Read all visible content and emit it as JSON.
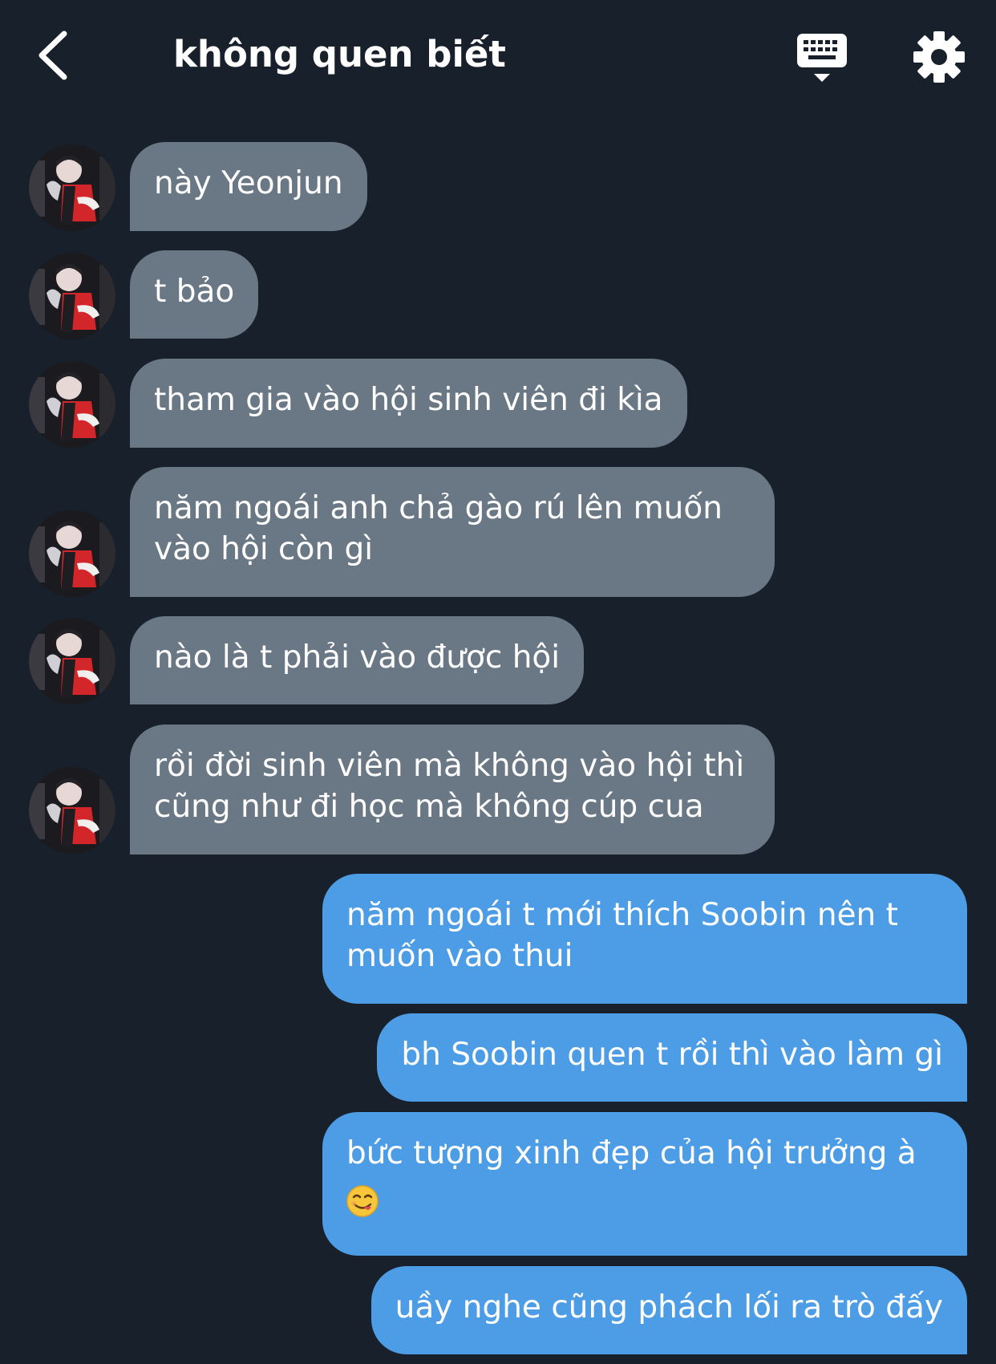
{
  "header": {
    "title": "không quen biết",
    "icons": {
      "back": "chevron-left-icon",
      "keyboard": "keyboard-icon",
      "settings": "gear-icon"
    }
  },
  "messages": [
    {
      "side": "in",
      "lines": [
        "này Yeonjun"
      ]
    },
    {
      "side": "in",
      "lines": [
        "t bảo"
      ]
    },
    {
      "side": "in",
      "lines": [
        "tham gia vào hội sinh viên đi kìa"
      ]
    },
    {
      "side": "in",
      "lines": [
        "năm ngoái anh chả gào rú lên muốn",
        "vào hội còn gì"
      ]
    },
    {
      "side": "in",
      "lines": [
        "nào là t phải vào được hội"
      ]
    },
    {
      "side": "in",
      "lines": [
        "rồi đời sinh viên mà không vào hội thì",
        "cũng như đi học mà không cúp cua"
      ]
    },
    {
      "side": "out",
      "lines": [
        "năm ngoái t mới thích Soobin nên t",
        "muốn vào thui"
      ]
    },
    {
      "side": "out",
      "lines": [
        "bh Soobin quen t rồi thì vào làm gì"
      ]
    },
    {
      "side": "out",
      "lines": [
        "bức tượng xinh đẹp của hội trưởng à"
      ],
      "emoji": "yum-face-emoji"
    },
    {
      "side": "out",
      "lines": [
        "uầy nghe cũng phách lối ra trò đấy"
      ]
    }
  ],
  "colors": {
    "background": "#18202b",
    "incoming_bubble": "#6a7784",
    "outgoing_bubble": "#4d9ce6",
    "text": "#ffffff"
  }
}
